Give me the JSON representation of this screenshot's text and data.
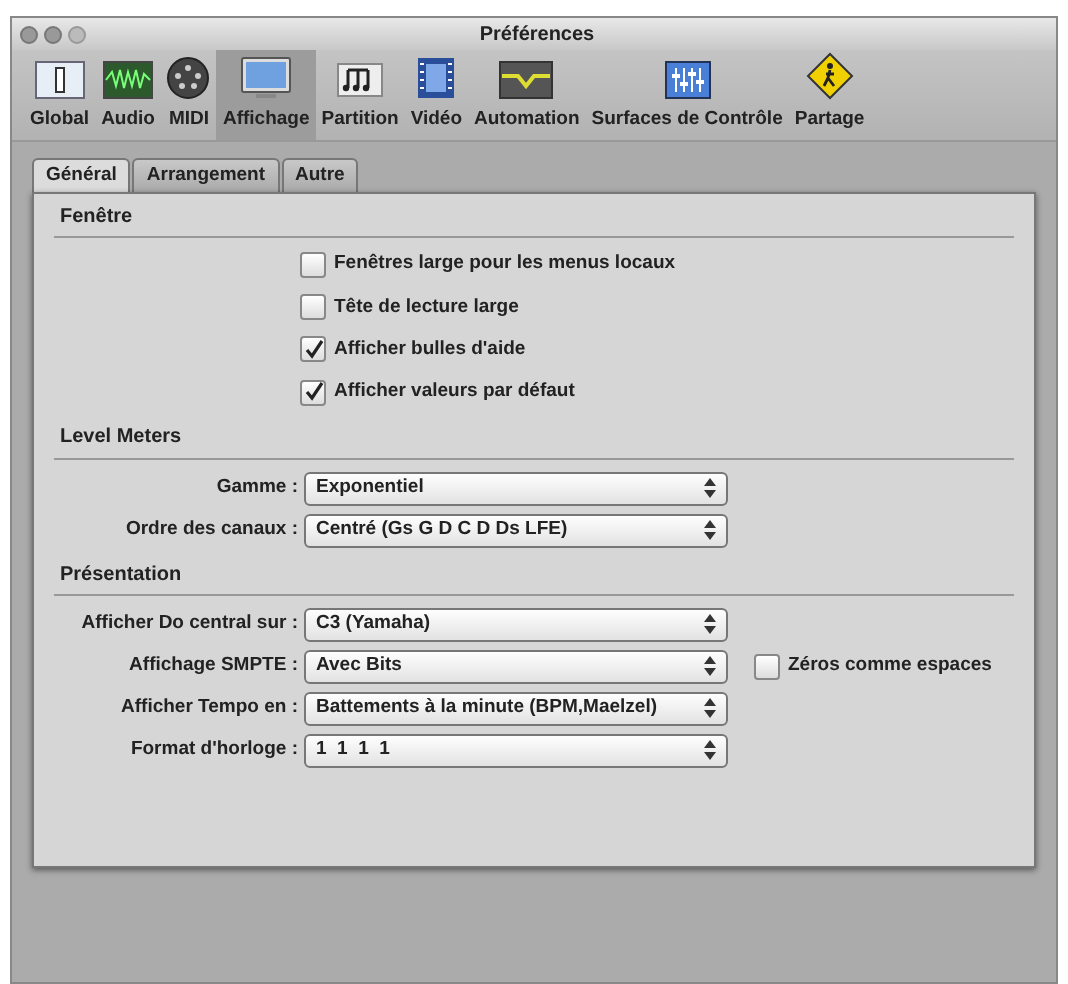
{
  "window": {
    "title": "Préférences"
  },
  "toolbar": [
    {
      "label": "Global",
      "selected": false
    },
    {
      "label": "Audio",
      "selected": false
    },
    {
      "label": "MIDI",
      "selected": false
    },
    {
      "label": "Affichage",
      "selected": true
    },
    {
      "label": "Partition",
      "selected": false
    },
    {
      "label": "Vidéo",
      "selected": false
    },
    {
      "label": "Automation",
      "selected": false
    },
    {
      "label": "Surfaces de Contrôle",
      "selected": false
    },
    {
      "label": "Partage",
      "selected": false
    }
  ],
  "tabs": [
    {
      "label": "Général",
      "selected": true
    },
    {
      "label": "Arrangement",
      "selected": false
    },
    {
      "label": "Autre",
      "selected": false
    }
  ],
  "sections": [
    {
      "title": "Fenêtre",
      "kind": "checkboxes",
      "items": [
        {
          "label": "Fenêtres large pour les menus locaux",
          "checked": false
        },
        {
          "label": "Tête de lecture large",
          "checked": false
        },
        {
          "label": "Afficher bulles d'aide",
          "checked": true
        },
        {
          "label": "Afficher valeurs par défaut",
          "checked": true
        }
      ]
    },
    {
      "title": "Level Meters",
      "kind": "popups",
      "items": [
        {
          "label": "Gamme :",
          "value": "Exponentiel"
        },
        {
          "label": "Ordre des canaux :",
          "value": "Centré (Gs G D C D Ds LFE)"
        }
      ]
    },
    {
      "title": "Présentation",
      "kind": "popups",
      "items": [
        {
          "label": "Afficher Do central sur :",
          "value": "C3 (Yamaha)"
        },
        {
          "label": "Affichage SMPTE :",
          "value": "Avec Bits",
          "extra": {
            "label": "Zéros comme espaces",
            "checked": false
          }
        },
        {
          "label": "Afficher Tempo en :",
          "value": "Battements à la minute (BPM,Maelzel)"
        },
        {
          "label": "Format d'horloge :",
          "value": "1  1  1  1"
        }
      ]
    }
  ]
}
